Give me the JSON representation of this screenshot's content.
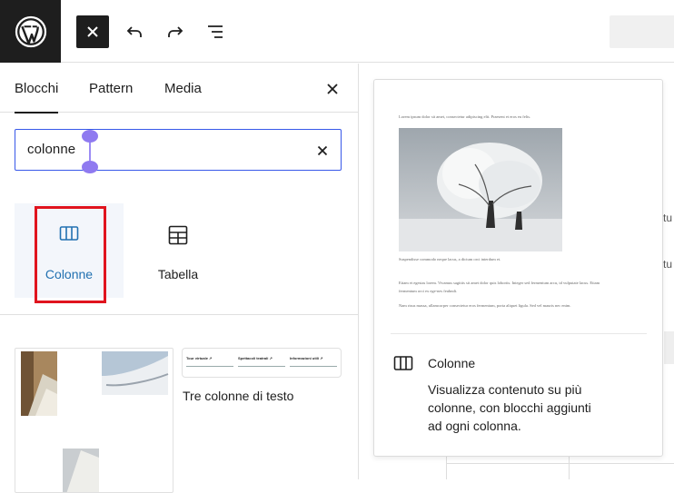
{
  "toolbar": {
    "logo": "wordpress-logo",
    "close": "close-icon",
    "undo": "undo-icon",
    "redo": "redo-icon",
    "outline": "list-view-icon"
  },
  "inserter": {
    "tabs": [
      "Blocchi",
      "Pattern",
      "Media"
    ],
    "active_tab": "Blocchi",
    "search_value": "colonne",
    "blocks": [
      {
        "label": "Colonne",
        "icon": "columns-icon",
        "selected": true
      },
      {
        "label": "Tabella",
        "icon": "table-icon",
        "selected": false
      }
    ],
    "patterns": [
      {
        "label": ""
      },
      {
        "label": "Tre colonne di testo",
        "mini_titles": [
          "Tour virtuale ↗",
          "Spettacoli teatrali ↗",
          "Informazioni utili ↗"
        ]
      }
    ]
  },
  "preview": {
    "intro": "Lorem ipsum dolor sit amet, consectetur adipiscing elit. Praesent et eros eu felis.",
    "caption": "Suspendisse commodo neque lacus, a dictum orci interdum et.",
    "para1": "Etiam et egestas lorem. Vivamus sagittis sit amet dolor quis lobortis. Integer sed fermentum arcu, id vulputate lacus. Etiam",
    "para1b": "fermentum orci ex ege-nes feubndi.",
    "para2": "Nam risus massa, ullamcorper consectetur eros fermentum, porta aliquet ligula. Sed vel mauris nec enim.",
    "title": "Colonne",
    "description": "Visualizza contenuto su più colonne, con blocchi aggiunti ad ogni colonna.",
    "icon": "columns-icon"
  },
  "canvas": {
    "edge_1": "tu",
    "edge_2": "tu"
  },
  "colors": {
    "accent": "#3858e9",
    "selected_text": "#2271b1",
    "highlight": "#e0141e",
    "dark": "#1e1e1e"
  }
}
